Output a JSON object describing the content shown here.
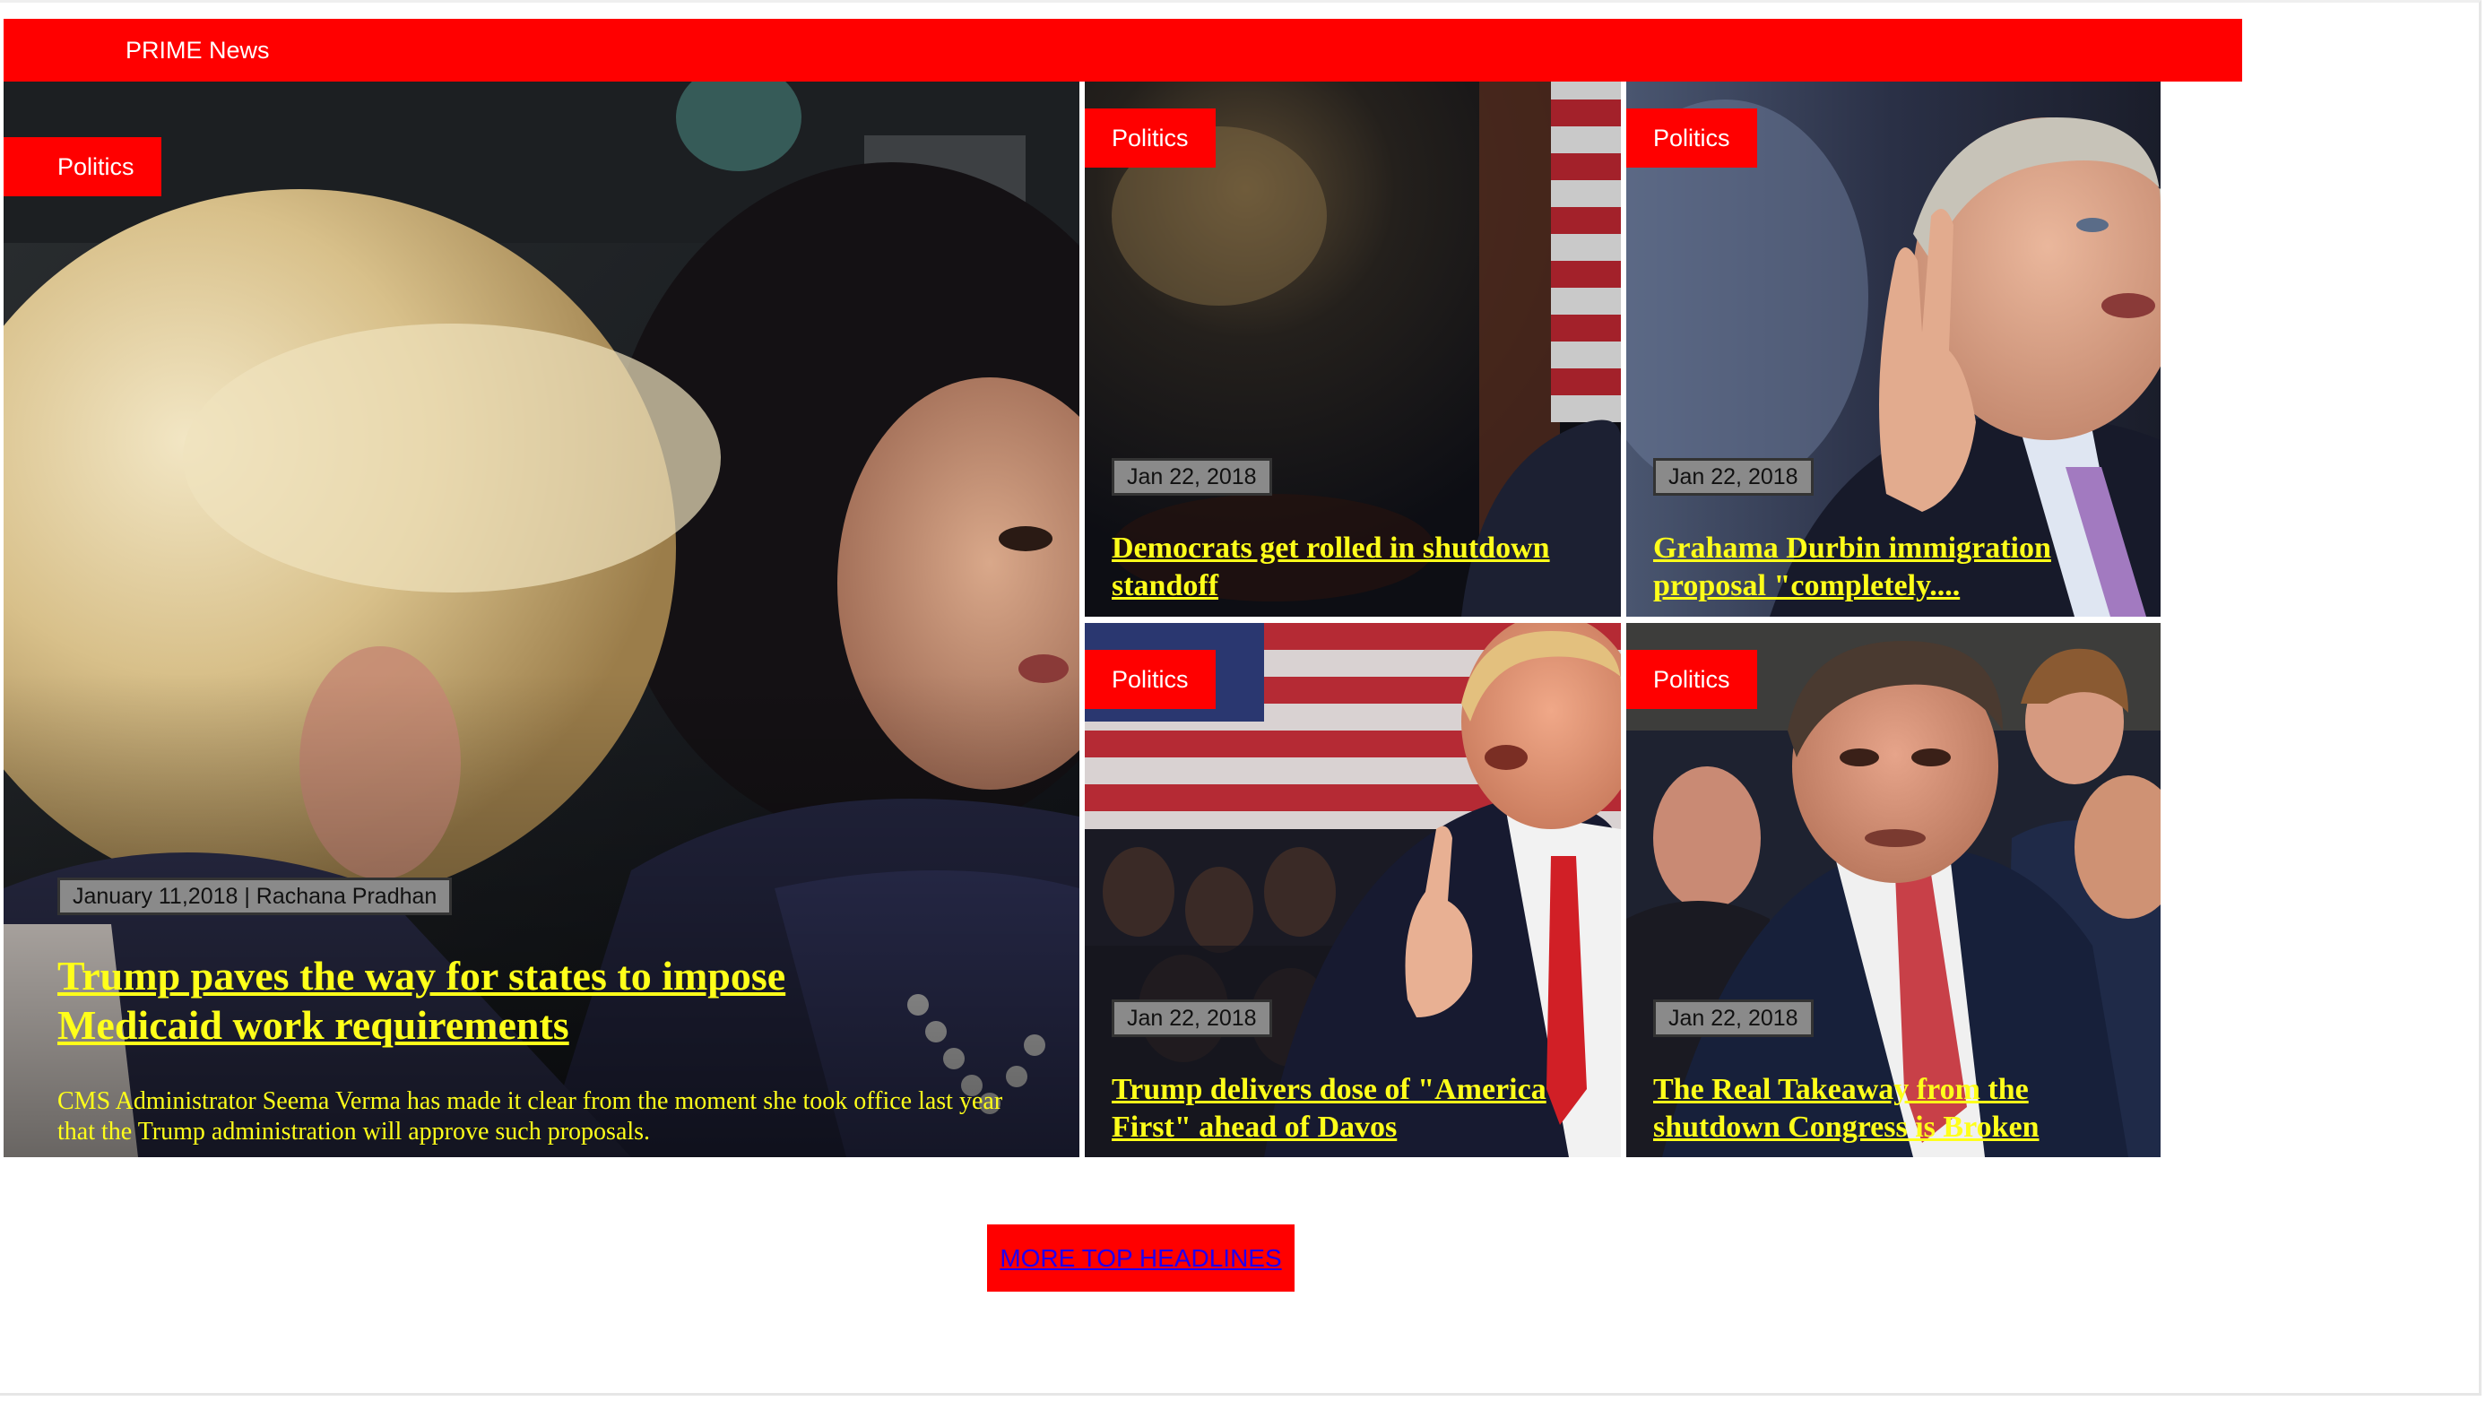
{
  "navbar": {
    "brand": "PRIME News",
    "color": "#ff0000"
  },
  "featured": {
    "category": "Politics",
    "meta": "January 11,2018 | Rachana Pradhan",
    "headline": "Trump paves the way for states to impose Medicaid work requirements",
    "summary": "CMS Administrator Seema Verma has made it clear from the moment she took office last year that the Trump administration will approve such proposals."
  },
  "stories": [
    {
      "category": "Politics",
      "date": "Jan 22, 2018",
      "headline": "Democrats get rolled in shutdown standoff"
    },
    {
      "category": "Politics",
      "date": "Jan 22, 2018",
      "headline": "Grahama Durbin immigration proposal \"completely...."
    },
    {
      "category": "Politics",
      "date": "Jan 22, 2018",
      "headline": "Trump delivers dose of \"America First\" ahead of Davos"
    },
    {
      "category": "Politics",
      "date": "Jan 22, 2018",
      "headline": "The Real Takeaway from the shutdown Congress is Broken"
    }
  ],
  "more_button": {
    "label": "MORE TOP HEADLINES"
  },
  "colors": {
    "accent": "#ff0000",
    "headline": "#ffff1a",
    "date_badge": "#8a8a8a"
  }
}
